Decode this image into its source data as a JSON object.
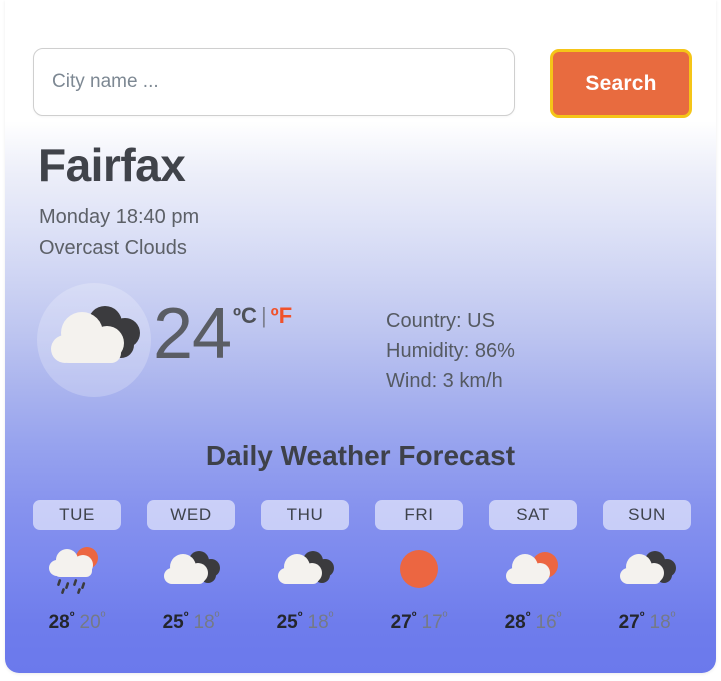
{
  "search": {
    "placeholder": "City name ...",
    "value": "",
    "button_label": "Search"
  },
  "current": {
    "city": "Fairfax",
    "time": "Monday 18:40 pm",
    "description": "Overcast Clouds",
    "icon": "overcast-clouds-icon",
    "temperature": "24",
    "unit_celsius": "ºC",
    "unit_separator": "|",
    "unit_fahrenheit": "ºF",
    "active_unit": "celsius",
    "details": [
      "Country: US",
      "Humidity: 86%",
      "Wind: 3 km/h"
    ]
  },
  "forecast": {
    "title": "Daily Weather Forecast",
    "days": [
      {
        "day": "TUE",
        "icon": "rain-with-sun-icon",
        "high": "28",
        "low": "20",
        "deg": "º"
      },
      {
        "day": "WED",
        "icon": "overcast-clouds-icon",
        "high": "25",
        "low": "18",
        "deg": "º"
      },
      {
        "day": "THU",
        "icon": "overcast-clouds-icon",
        "high": "25",
        "low": "18",
        "deg": "º"
      },
      {
        "day": "FRI",
        "icon": "clear-sun-icon",
        "high": "27",
        "low": "17",
        "deg": "º"
      },
      {
        "day": "SAT",
        "icon": "partly-cloudy-icon",
        "high": "28",
        "low": "16",
        "deg": "º"
      },
      {
        "day": "SUN",
        "icon": "overcast-clouds-icon",
        "high": "27",
        "low": "18",
        "deg": "º"
      }
    ]
  },
  "colors": {
    "accent_orange": "#e86b3f",
    "focus_ring": "#f5c518",
    "unit_active": "#4e5158",
    "unit_inactive": "#f0522b",
    "card_top": "#ffffff",
    "card_bottom": "#6b79ec",
    "cloud_light": "#f4f2ee",
    "cloud_dark": "#3b3b3e",
    "sun": "#ec6641"
  }
}
